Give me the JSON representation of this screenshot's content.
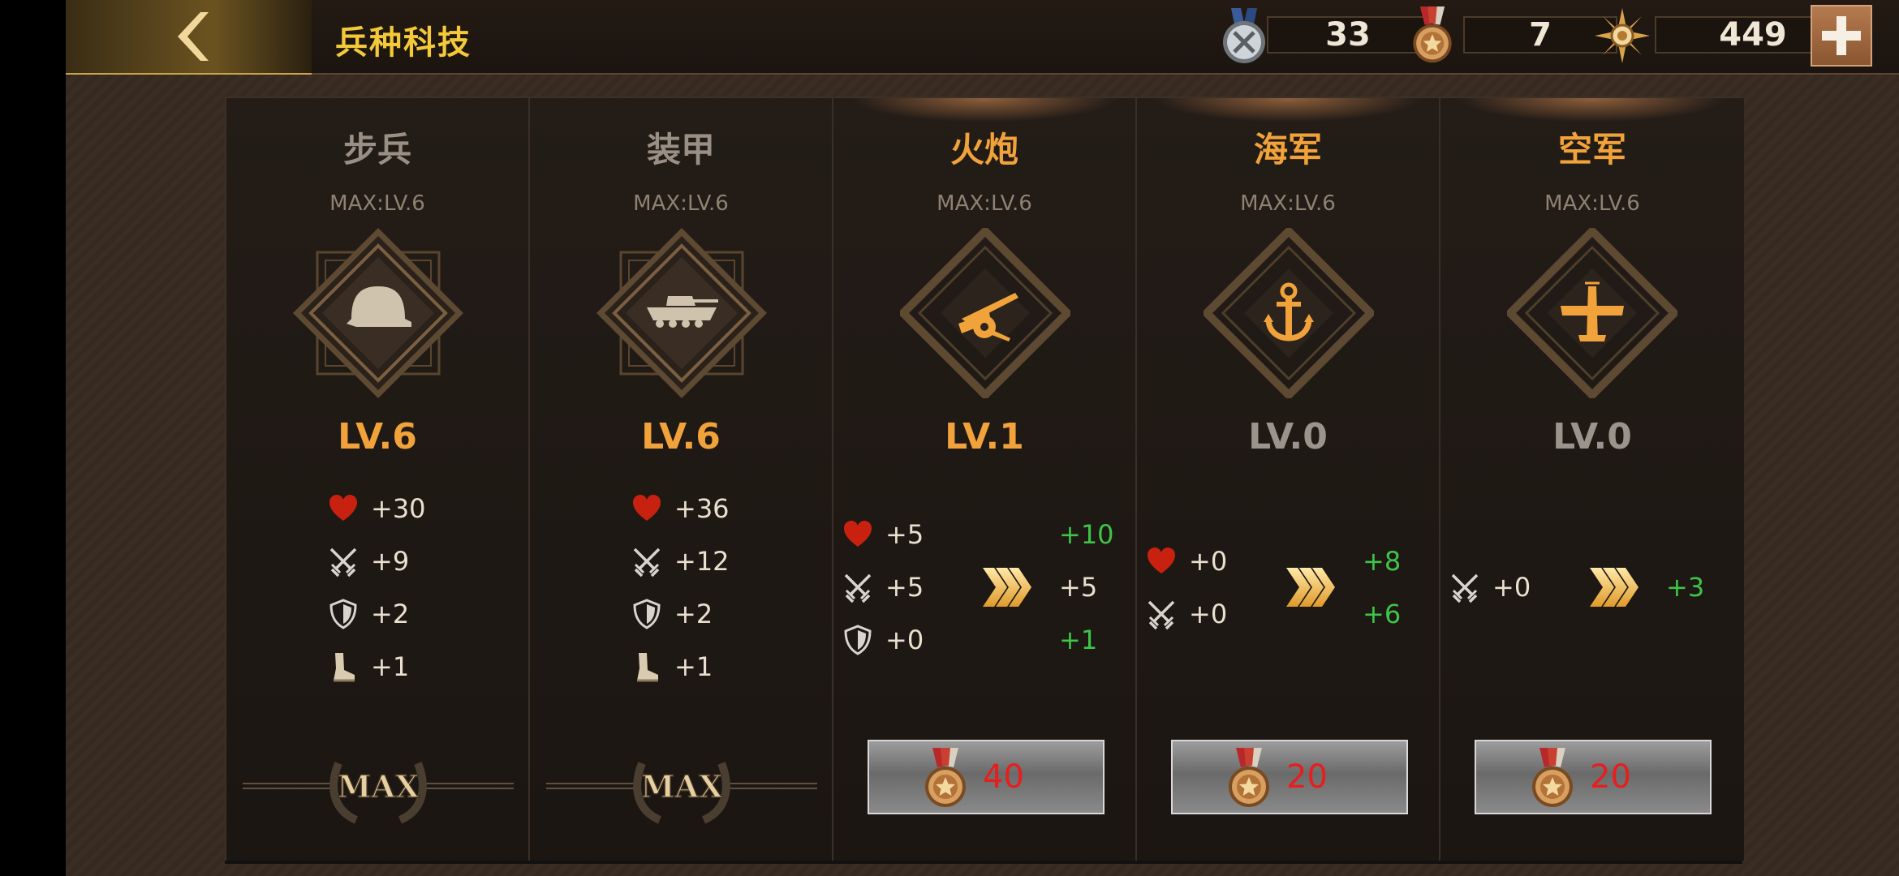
{
  "header": {
    "title": "兵种科技",
    "resources": [
      {
        "icon": "silver-medal-icon",
        "value": "33"
      },
      {
        "icon": "bronze-medal-icon",
        "value": "7"
      },
      {
        "icon": "gold-badge-icon",
        "value": "449"
      }
    ]
  },
  "colors": {
    "active_title": "#f2a23a",
    "inactive_title": "#9a8f84",
    "gain": "#3ec447",
    "cost": "#e81d1d"
  },
  "columns": [
    {
      "title": "步兵",
      "max": "MAX:LV.6",
      "level": "LV.6",
      "icon": "helmet-icon",
      "stats": [
        "+30",
        "+9",
        "+2",
        "+1"
      ],
      "badge": "MAX"
    },
    {
      "title": "装甲",
      "max": "MAX:LV.6",
      "level": "LV.6",
      "icon": "tank-icon",
      "stats": [
        "+36",
        "+12",
        "+2",
        "+1"
      ],
      "badge": "MAX"
    },
    {
      "title": "火炮",
      "max": "MAX:LV.6",
      "level": "LV.1",
      "icon": "artillery-icon",
      "stats": [
        "+5",
        "+5",
        "+0"
      ],
      "next": [
        "+10",
        "+5",
        "+1"
      ],
      "cost": "40"
    },
    {
      "title": "海军",
      "max": "MAX:LV.6",
      "level": "LV.0",
      "icon": "anchor-icon",
      "stats": [
        "+0",
        "+0"
      ],
      "next": [
        "+8",
        "+6"
      ],
      "cost": "20"
    },
    {
      "title": "空军",
      "max": "MAX:LV.6",
      "level": "LV.0",
      "icon": "plane-icon",
      "stats": [
        "+0"
      ],
      "next": [
        "+3"
      ],
      "cost": "20"
    }
  ]
}
